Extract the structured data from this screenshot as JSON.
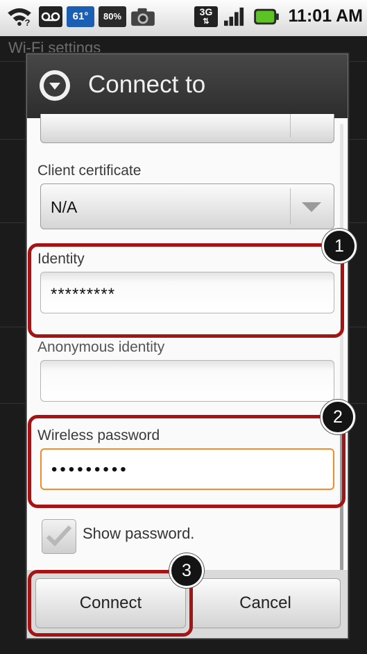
{
  "status_bar": {
    "time": "11:01 AM",
    "icons": [
      "wifi-question-icon",
      "voicemail-icon",
      "temperature-icon",
      "battery-percent-icon",
      "camera-icon",
      "3g-icon",
      "signal-icon",
      "battery-icon"
    ],
    "temperature_text": "61°",
    "battery_percent_text": "80%",
    "network_text": "3G"
  },
  "background": {
    "title": "Wi-Fi settings"
  },
  "dialog": {
    "title": "Connect to",
    "fields": {
      "client_certificate": {
        "label": "Client certificate",
        "value": "N/A"
      },
      "identity": {
        "label": "Identity",
        "value": "*********"
      },
      "anonymous_identity": {
        "label": "Anonymous identity",
        "value": ""
      },
      "wireless_password": {
        "label": "Wireless password",
        "value": "•••••••••"
      }
    },
    "show_password": {
      "label": "Show password.",
      "checked": true
    },
    "buttons": {
      "connect": "Connect",
      "cancel": "Cancel"
    }
  },
  "callouts": {
    "identity": "1",
    "password": "2",
    "connect": "3"
  },
  "colors": {
    "callout": "#a41414",
    "focus": "#f08d2a",
    "header": "#3a3a3a"
  }
}
